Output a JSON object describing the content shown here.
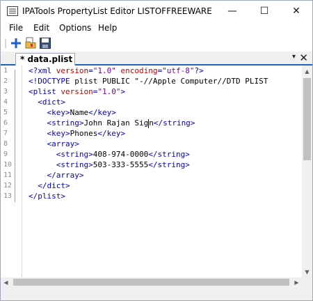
{
  "window": {
    "title": "IPATools PropertyList Editor LISTOFFREEWARE",
    "minimize_glyph": "—",
    "maximize_glyph": "☐",
    "close_glyph": "✕"
  },
  "menu": {
    "items": [
      "File",
      "Edit",
      "Options",
      "Help"
    ]
  },
  "toolbar": {
    "buttons": [
      "add-icon",
      "open-folder-icon",
      "save-icon"
    ]
  },
  "tab": {
    "label": "* data.plist",
    "dropdown_glyph": "▾",
    "close_glyph": "✕"
  },
  "editor": {
    "line_numbers": [
      "1",
      "2",
      "3",
      "4",
      "5",
      "6",
      "7",
      "8",
      "9",
      "10",
      "11",
      "12",
      "13"
    ],
    "lines": [
      "<?xml version=\"1.0\" encoding=\"utf-8\"?>",
      "<!DOCTYPE plist PUBLIC \"-//Apple Computer//DTD PLIST",
      "<plist version=\"1.0\">",
      "  <dict>",
      "    <key>Name</key>",
      "    <string>John Rajan Sign</string>",
      "    <key>Phones</key>",
      "    <array>",
      "      <string>408-974-0000</string>",
      "      <string>503-333-5555</string>",
      "    </array>",
      "  </dict>",
      "</plist>"
    ]
  },
  "colors": {
    "tag": "#0000c8",
    "attribute": "#c00000",
    "value": "#7a00a0",
    "text": "#000000",
    "tab_accent": "#1f62c6"
  }
}
